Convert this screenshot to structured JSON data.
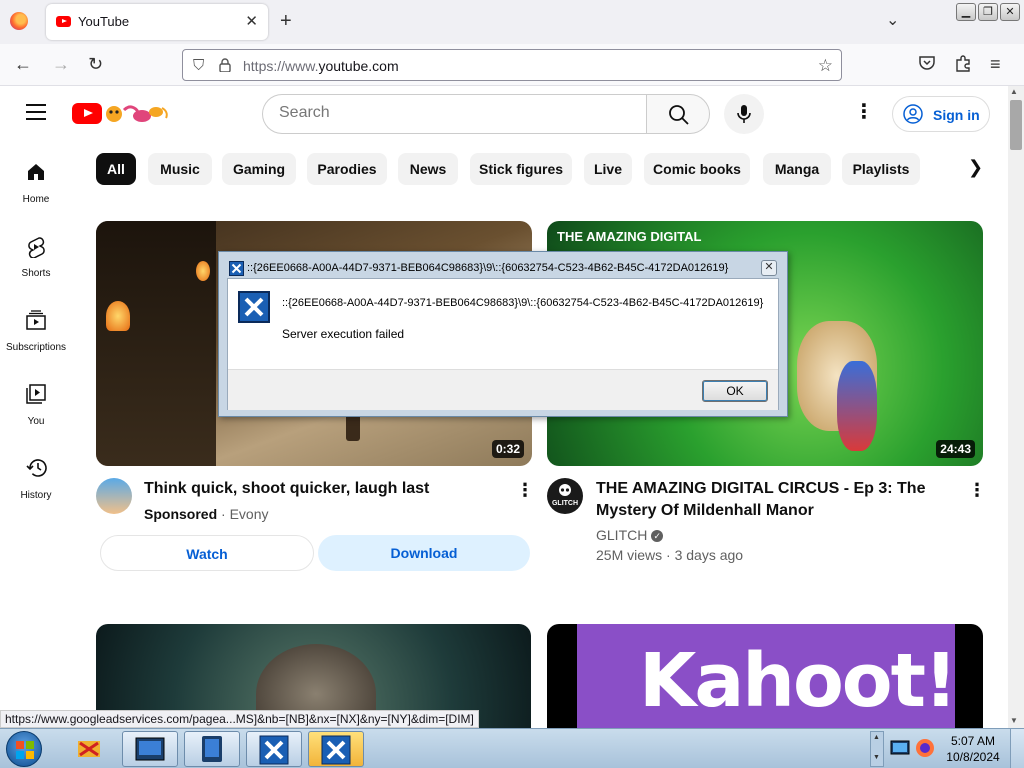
{
  "browser": {
    "tab_title": "YouTube",
    "url_dim": "https://www.",
    "url_main": "youtube.com"
  },
  "youtube": {
    "search_placeholder": "Search",
    "sign_in": "Sign in",
    "sidebar": [
      {
        "label": "Home",
        "icon": "home-icon"
      },
      {
        "label": "Shorts",
        "icon": "shorts-icon"
      },
      {
        "label": "Subscriptions",
        "icon": "subscriptions-icon"
      },
      {
        "label": "You",
        "icon": "you-icon"
      },
      {
        "label": "History",
        "icon": "history-icon"
      }
    ],
    "chips": [
      "All",
      "Music",
      "Gaming",
      "Parodies",
      "News",
      "Stick figures",
      "Live",
      "Comic books",
      "Manga",
      "Playlists"
    ],
    "videos": [
      {
        "title": "Think quick, shoot quicker, laugh last",
        "sponsored": "Sponsored",
        "channel": "Evony",
        "duration": "0:32",
        "watch_label": "Watch",
        "download_label": "Download"
      },
      {
        "title_line1": "THE AMAZING DIGITAL CIRCUS - Ep 3: The",
        "title_line2": "Mystery Of Mildenhall Manor",
        "channel": "GLITCH",
        "views": "25M views",
        "age": "3 days ago",
        "duration": "24:43",
        "avatar_text": "GLITCH",
        "thumb_text": "THE AMAZING DIGITAL"
      },
      {
        "thumb_text": ""
      },
      {
        "thumb_text": "Kahoot!"
      }
    ]
  },
  "status_link": "https://www.googleadservices.com/pagea...MS]&nb=[NB]&nx=[NX]&ny=[NY]&dim=[DIM]",
  "dialog": {
    "title": "::{26EE0668-A00A-44D7-9371-BEB064C98683}\\9\\::{60632754-C523-4B62-B45C-4172DA012619}",
    "message": "::{26EE0668-A00A-44D7-9371-BEB064C98683}\\9\\::{60632754-C523-4B62-B45C-4172DA012619}",
    "detail": "Server execution failed",
    "ok_label": "OK"
  },
  "taskbar": {
    "time": "5:07 AM",
    "date": "10/8/2024"
  },
  "colors": {
    "yt_red": "#ff0000",
    "link_blue": "#065fd4",
    "chip_active": "#0f0f0f"
  }
}
